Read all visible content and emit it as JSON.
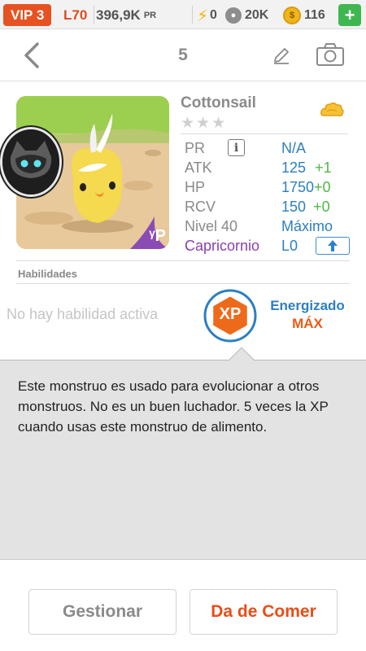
{
  "status_bar": {
    "vip": "VIP 3",
    "level": "L70",
    "pr_value": "396,9K",
    "pr_unit": "PR",
    "energy": "0",
    "food": "20K",
    "coins": "116",
    "add_label": "+"
  },
  "header": {
    "title": "5"
  },
  "monster": {
    "name": "Cottonsail",
    "stars": "★★★",
    "portrait_badge": "ᵞP",
    "stats": {
      "pr_label": "PR",
      "pr_value": "N/A",
      "atk_label": "ATK",
      "atk_value": "125",
      "atk_bonus": "+1",
      "hp_label": "HP",
      "hp_value": "1750",
      "hp_bonus": "+0",
      "rcv_label": "RCV",
      "rcv_value": "150",
      "rcv_bonus": "+0",
      "level_label": "Nivel 40",
      "level_value": "Máximo",
      "zodiac_label": "Capricornio",
      "zodiac_value": "L0"
    }
  },
  "skills": {
    "section_title": "Habilidades",
    "empty_text": "No hay habilidad activa",
    "badge_text": "XP",
    "energized_label": "Energizado",
    "energized_value": "MÁX"
  },
  "description": {
    "text": "Este monstruo es usado para evolucionar a otros monstruos. No es un buen luchador. 5 veces la XP cuando usas este monstruo de alimento."
  },
  "actions": {
    "manage_label": "Gestionar",
    "feed_label": "Da de Comer"
  },
  "colors": {
    "accent_orange": "#ea4d16",
    "accent_blue": "#2d7fc1",
    "bonus_green": "#4fb848",
    "zodiac_purple": "#8a3fb0"
  }
}
